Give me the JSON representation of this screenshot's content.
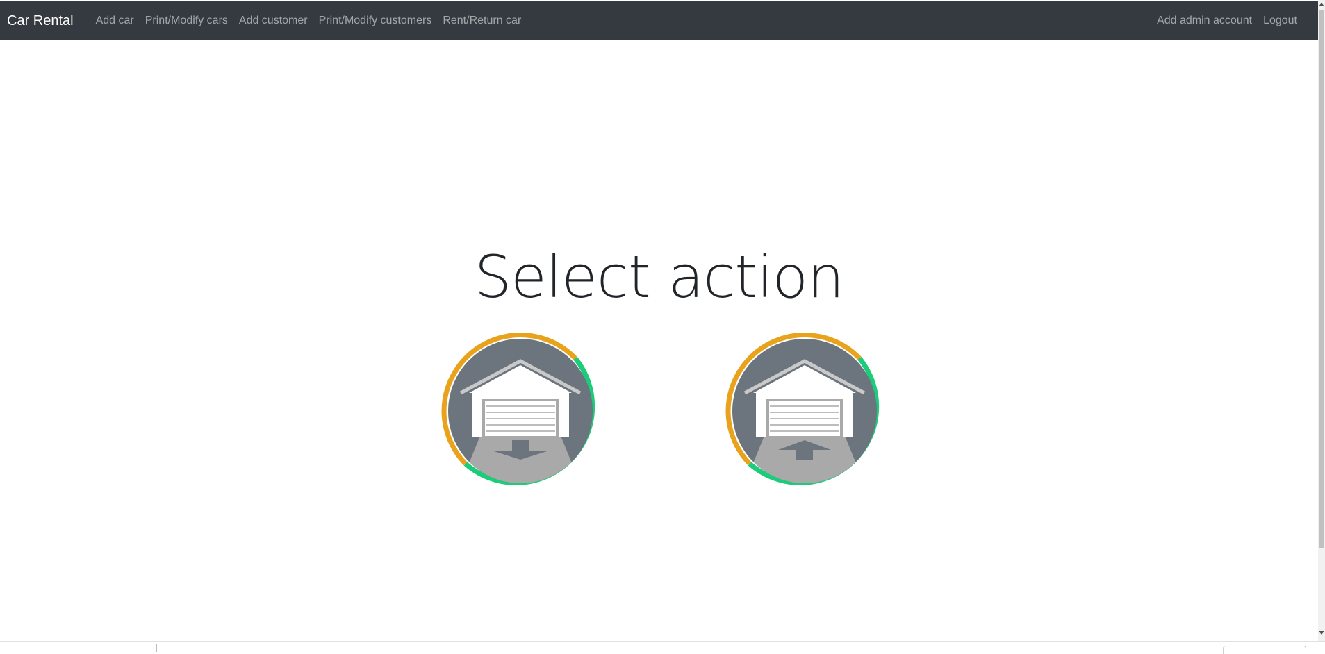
{
  "navbar": {
    "brand": "Car Rental",
    "left_links": [
      "Add car",
      "Print/Modify cars",
      "Add customer",
      "Print/Modify customers",
      "Rent/Return car"
    ],
    "right_links": [
      "Add admin account",
      "Logout"
    ]
  },
  "main": {
    "title": "Select action",
    "actions": [
      {
        "icon": "garage-rent-car-out-icon"
      },
      {
        "icon": "garage-return-car-in-icon"
      }
    ]
  },
  "colors": {
    "navbar_bg": "#343a40",
    "ring_orange": "#e8a21c",
    "ring_green": "#1ccc7a",
    "icon_bg": "#6c757d"
  }
}
